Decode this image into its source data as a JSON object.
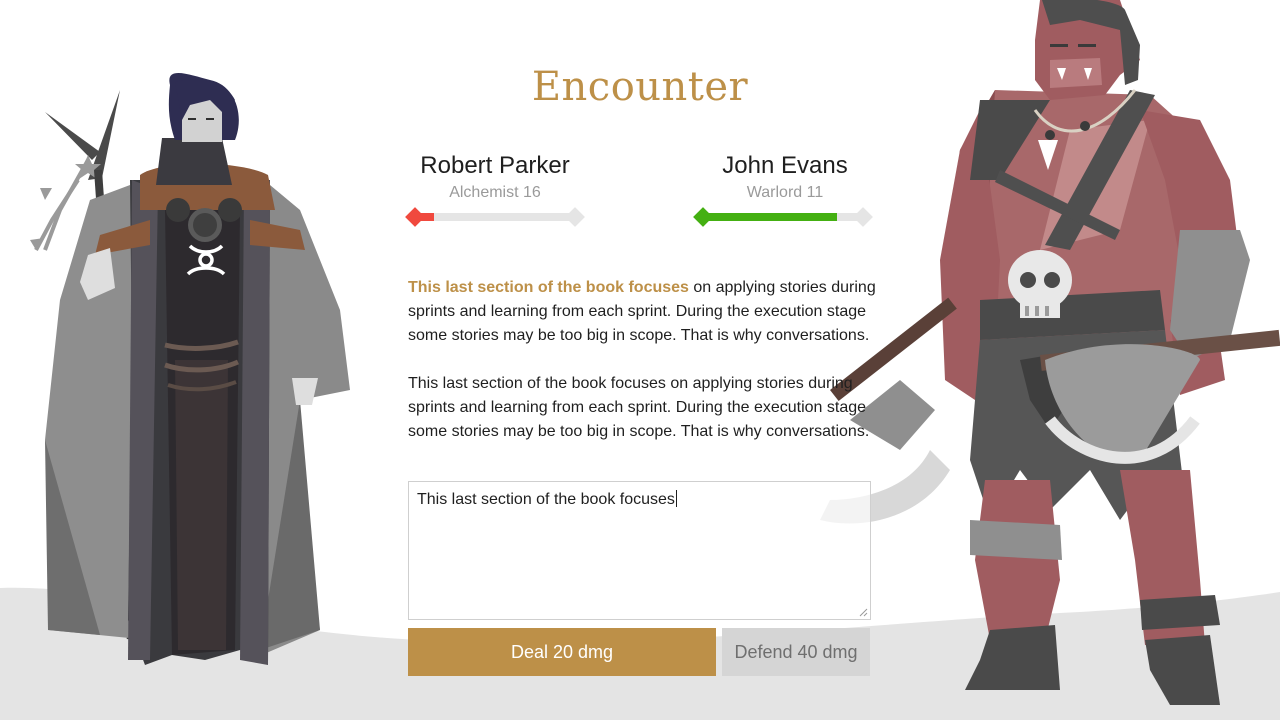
{
  "encounter": {
    "title": "Encounter"
  },
  "player": {
    "name": "Robert Parker",
    "class_level": "Alchemist 16",
    "hp_fraction": 0.12,
    "hp_color": "#f0493e"
  },
  "enemy": {
    "name": "John Evans",
    "class_level": "Warlord 11",
    "hp_fraction": 0.84,
    "hp_color": "#44b012"
  },
  "story": {
    "p1_highlight": "This last section of the book focuses",
    "p1_rest": " on applying stories during sprints and learning from each sprint. During the execution stage some stories may be too big in scope. That is why conversations.",
    "p2": "This last section of the book focuses on applying stories during sprints and learning from each sprint. During the execution stage some stories may be too big in scope. That is why conversations."
  },
  "input": {
    "value": "This last section of the book focuses"
  },
  "actions": {
    "attack_label": "Deal 20 dmg",
    "defend_label": "Defend 40 dmg"
  },
  "colors": {
    "accent": "#bd9048",
    "hp_track": "#e5e5e5",
    "defend_bg": "#d5d5d5"
  },
  "illustrations": {
    "left": "hooded-alchemist-illustration",
    "right": "orc-warlord-illustration"
  }
}
